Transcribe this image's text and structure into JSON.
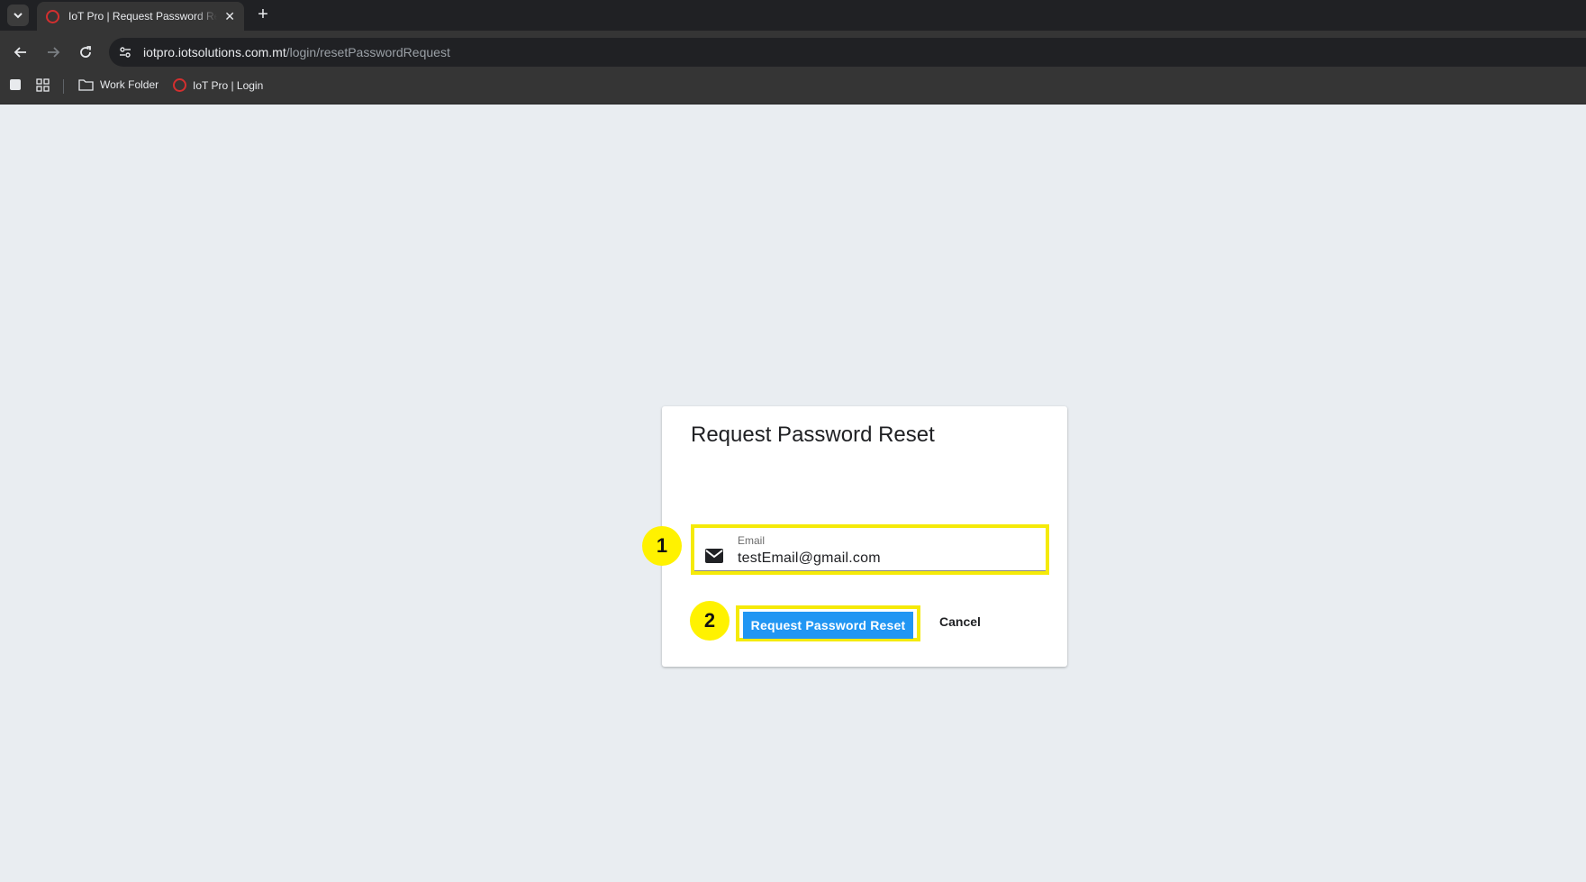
{
  "browser": {
    "tab": {
      "title": "IoT Pro | Request Password Reset",
      "close_glyph": "✕",
      "favicon": "iot-pro-ring-icon"
    },
    "new_tab_glyph": "+",
    "address_bar": {
      "url_host": "iotpro.iotsolutions.com.mt",
      "url_path": "/login/resetPasswordRequest"
    },
    "bookmarks": [
      {
        "label": "Work Folder",
        "icon": "folder-icon"
      },
      {
        "label": "IoT Pro | Login",
        "icon": "iot-pro-ring-icon"
      }
    ]
  },
  "dialog": {
    "title": "Request Password Reset",
    "email": {
      "label": "Email",
      "value": "testEmail@gmail.com",
      "icon": "mail-icon"
    },
    "submit_label": "Request Password Reset",
    "cancel_label": "Cancel"
  },
  "annotations": {
    "step_1": "1",
    "step_2": "2",
    "highlight_color": "#f5ea08",
    "badge_color": "#fff200"
  },
  "colors": {
    "primary": "#2196f3",
    "page_background": "#e9edf1"
  }
}
